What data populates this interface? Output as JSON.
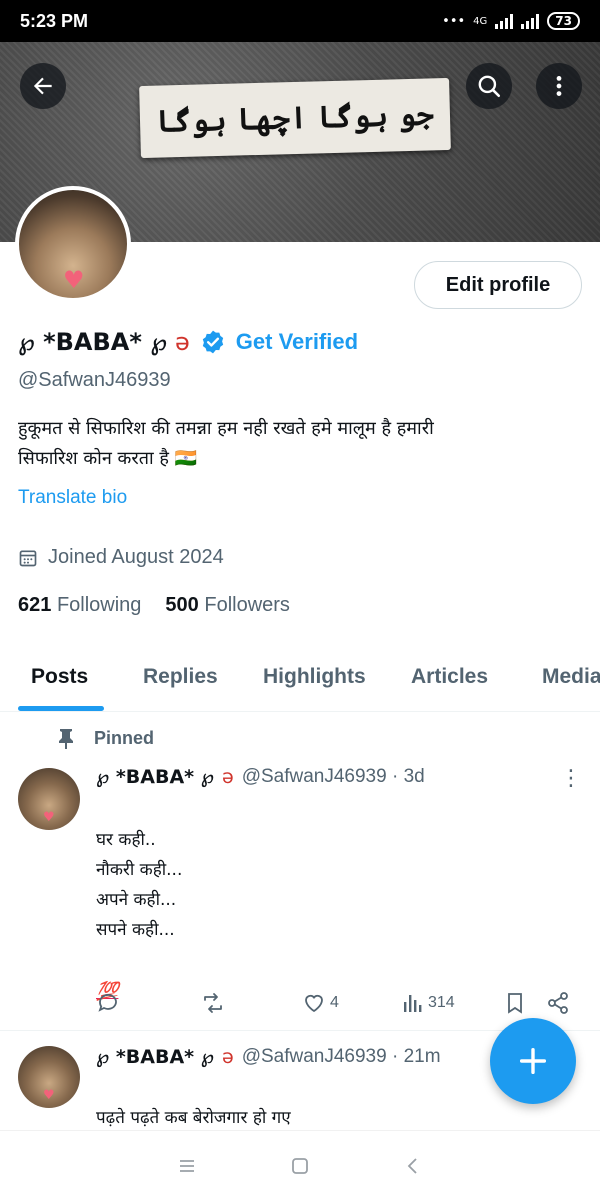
{
  "status_bar": {
    "time": "5:23 PM",
    "network": "4G",
    "battery": "73"
  },
  "banner": {
    "urdu_text": "جو ہوگا اچھا ہوگا"
  },
  "profile": {
    "display_name": "℘ *ΒΑΒΑ* ℘",
    "get_verified": "Get Verified",
    "handle": "@SafwanJ46939",
    "bio": "हुकूमत से सिफारिश की तमन्ना हम नही रखते  हमे मालूम है हमारी\nसिफारिश कोन करता है 🇮🇳",
    "translate_bio": "Translate bio",
    "joined": "Joined August 2024",
    "following_count": "621",
    "following_label": "Following",
    "followers_count": "500",
    "followers_label": "Followers",
    "edit_profile": "Edit profile"
  },
  "tabs": [
    "Posts",
    "Replies",
    "Highlights",
    "Articles",
    "Media"
  ],
  "pinned_label": "Pinned",
  "posts": [
    {
      "name": "℘ *ΒΑΒΑ* ℘",
      "meta": "@SafwanJ46939 · 3d",
      "text": "घर कही..\nनौकरी कही...\nअपने कही...\nसपने कही...",
      "emoji": "💯",
      "likes": "4",
      "views": "314"
    },
    {
      "name": "℘ *ΒΑΒΑ* ℘",
      "meta": "@SafwanJ46939 · 21m",
      "text": "पढ़ते पढ़ते कब बेरोजगार हो गए\nपता ही नहीं चला... 💯"
    }
  ],
  "colors": {
    "accent": "#1d9bf0",
    "text": "#0f1419",
    "secondary": "#536471"
  }
}
